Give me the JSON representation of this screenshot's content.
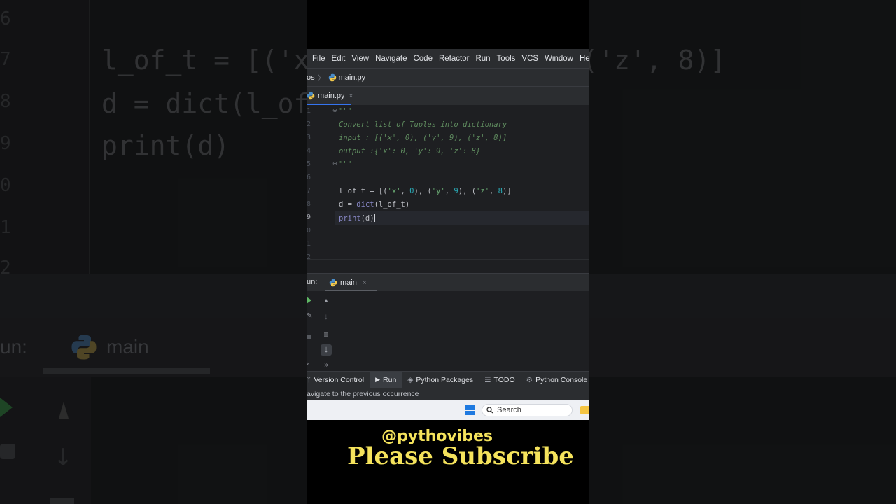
{
  "background": {
    "code_lines": [
      "l_of_t = [('x', 0), ('y', 9), ('z', 8)]",
      "d = dict(l_of_t)",
      "print(d)"
    ],
    "gutter_numbers": [
      "6",
      "7",
      "8",
      "9",
      "0",
      "1",
      "2"
    ],
    "run_label": "un:",
    "run_tab_label": "main"
  },
  "menubar": {
    "items": [
      "File",
      "Edit",
      "View",
      "Navigate",
      "Code",
      "Refactor",
      "Run",
      "Tools",
      "VCS",
      "Window",
      "Help"
    ]
  },
  "breadcrumb": {
    "project": "os",
    "file": "main.py"
  },
  "editor_tab": {
    "label": "main.py",
    "close": "×"
  },
  "editor": {
    "line_numbers": [
      "1",
      "2",
      "3",
      "4",
      "5",
      "6",
      "7",
      "8",
      "9",
      "0",
      "1",
      "2"
    ],
    "current_line_number": "9",
    "docstring": [
      "\"\"\"",
      "Convert list of Tuples into dictionary",
      "input : [('x', 0), ('y', 9), ('z', 8)]",
      "output :{'x': 0, 'y': 9, 'z': 8}",
      "\"\"\""
    ],
    "code": {
      "line7_a": "l_of_t = [(",
      "line7_s1": "'x'",
      "line7_b": ", ",
      "line7_n1": "0",
      "line7_c": "), (",
      "line7_s2": "'y'",
      "line7_d": ", ",
      "line7_n2": "9",
      "line7_e": "), (",
      "line7_s3": "'z'",
      "line7_f": ", ",
      "line7_n3": "8",
      "line7_g": ")]",
      "line8_a": "d = ",
      "line8_fn": "dict",
      "line8_b": "(l_of_t)",
      "line9_fn": "print",
      "line9_b": "(d)"
    }
  },
  "run_panel": {
    "label": "un:",
    "tab_label": "main",
    "close": "×"
  },
  "toolstrip": {
    "items": [
      "Version Control",
      "Run",
      "Python Packages",
      "TODO",
      "Python Console"
    ],
    "selected": "Run"
  },
  "status_bar": {
    "text": "avigate to the previous occurrence"
  },
  "taskbar": {
    "search_placeholder": "Search"
  },
  "overlay": {
    "handle": "@pythovibes",
    "cta": "Please Subscribe"
  },
  "colors": {
    "accent": "#3574f0",
    "docstring": "#5f8c5f",
    "string": "#6aab73",
    "number": "#2aacb8",
    "builtin": "#8888c6",
    "overlay_text": "#f5e35c"
  }
}
